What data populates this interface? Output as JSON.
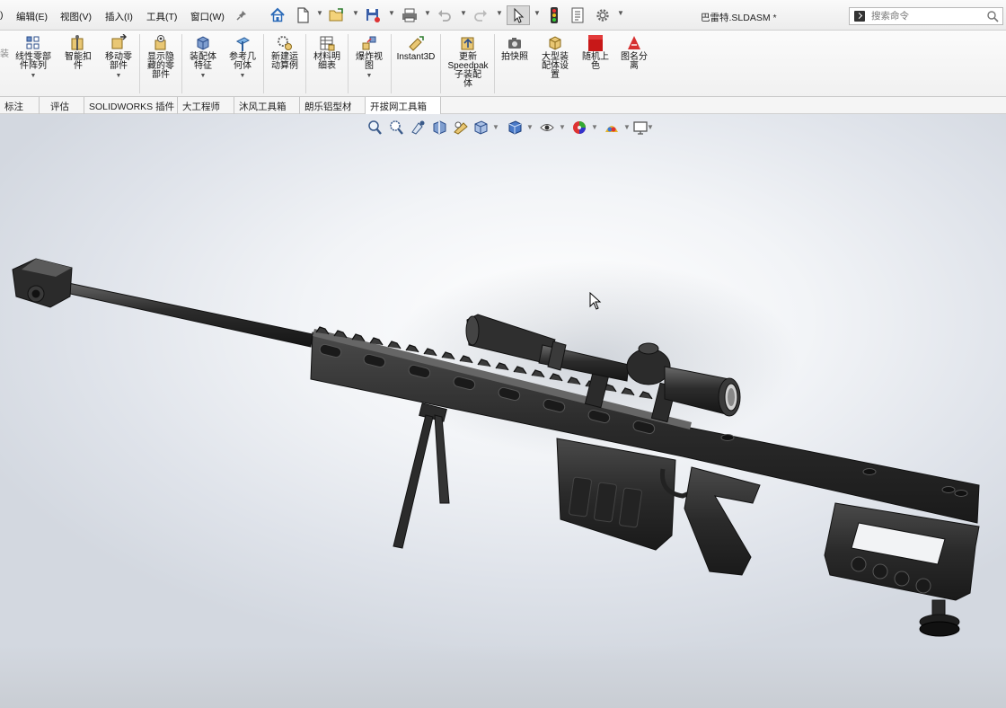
{
  "menubar": {
    "menus": [
      "视图(V)",
      "编辑(E)",
      "视图(V)",
      "插入(I)",
      "工具(T)",
      "窗口(W)"
    ],
    "menu_truncated_left": ")",
    "pin_icon": "pin-icon",
    "quick_icons": [
      "home-icon",
      "new-document-icon",
      "open-icon",
      "save-icon",
      "print-icon",
      "undo-icon",
      "redo-icon",
      "select-arrow-icon",
      "traffic-light-icon",
      "file-properties-icon",
      "options-gear-icon"
    ]
  },
  "window": {
    "title": "巴雷特.SLDASM *"
  },
  "search": {
    "placeholder": "搜索命令"
  },
  "ribbon": {
    "left_cut_label": "装",
    "buttons": [
      {
        "label": "线性零部\n件阵列",
        "icon": "linear-pattern-icon",
        "has_dropdown": true
      },
      {
        "label": "智能扣\n件",
        "icon": "smart-fastener-icon",
        "has_dropdown": false
      },
      {
        "label": "移动零\n部件",
        "icon": "move-component-icon",
        "has_dropdown": true
      },
      {
        "label": "显示隐\n藏的零\n部件",
        "icon": "show-hidden-icon",
        "has_dropdown": false
      },
      {
        "label": "装配体\n特征",
        "icon": "assembly-feature-icon",
        "has_dropdown": true
      },
      {
        "label": "参考几\n何体",
        "icon": "reference-geometry-icon",
        "has_dropdown": true
      },
      {
        "label": "新建运\n动算例",
        "icon": "motion-study-icon",
        "has_dropdown": false
      },
      {
        "label": "材料明\n细表",
        "icon": "bom-icon",
        "has_dropdown": false
      },
      {
        "label": "爆炸视\n图",
        "icon": "exploded-view-icon",
        "has_dropdown": true
      },
      {
        "label": "Instant3D",
        "icon": "instant3d-icon",
        "has_dropdown": false
      },
      {
        "label": "更新\nSpeedpak\n子装配\n体",
        "icon": "speedpak-icon",
        "has_dropdown": false
      },
      {
        "label": "拍快照",
        "icon": "snapshot-icon",
        "has_dropdown": false
      },
      {
        "label": "大型装\n配体设\n置",
        "icon": "large-assembly-icon",
        "has_dropdown": false
      },
      {
        "label": "随机上\n色",
        "icon": "random-color-icon",
        "has_dropdown": false
      },
      {
        "label": "图名分\n离",
        "icon": "name-split-icon",
        "has_dropdown": false
      }
    ]
  },
  "tabs": [
    "标注",
    "评估",
    "SOLIDWORKS 插件",
    "大工程师",
    "沐风工具箱",
    "朗乐铝型材",
    "开拔网工具箱"
  ],
  "hud_icons": [
    "zoom-fit-icon",
    "zoom-area-icon",
    "previous-view-icon",
    "section-view-icon",
    "dynamic-annotation-icon",
    "view-orientation-icon",
    "display-style-icon",
    "hide-show-items-icon",
    "edit-appearance-icon",
    "apply-scene-icon",
    "view-settings-icon"
  ],
  "colors": {
    "model": "#2b2b2b",
    "accent": "#d8a020"
  }
}
